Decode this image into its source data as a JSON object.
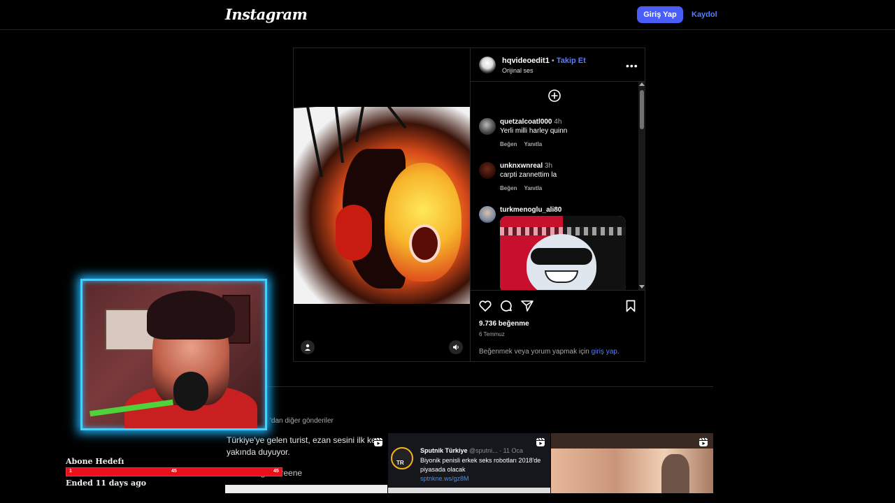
{
  "header": {
    "logo": "Instagram",
    "login_label": "Giriş Yap",
    "signup_label": "Kaydol"
  },
  "post": {
    "author": "hqvideoedit1",
    "separator": " • ",
    "follow_label": "Takip Et",
    "audio": "Orijinal ses",
    "more_label": "•••",
    "comments": [
      {
        "user": "quetzalcoatl000",
        "time": "4h",
        "text": "Yerli milli harley quinn",
        "like_label": "Beğen",
        "reply_label": "Yanıtla"
      },
      {
        "user": "unknxwnreal",
        "time": "3h",
        "text": "carpti zannettim la",
        "like_label": "Beğen",
        "reply_label": "Yanıtla"
      },
      {
        "user": "turkmenoglu_ali80"
      }
    ],
    "likes": "9.736 beğenme",
    "date": "6 Temmuz",
    "login_prompt_prefix": "Beğenmek veya yorum yapmak için ",
    "login_prompt_link": "giriş yap",
    "login_prompt_suffix": "."
  },
  "more_posts": {
    "heading": "'dan diğer gönderiler",
    "thumbs": [
      {
        "text": "Türkiye'ye gelen turist, ezan sesini ilk kez yakında duyuyor.",
        "name": "Danoğlu Greene"
      },
      {
        "logo_text": "TR",
        "account": "Sputnik Türkiye",
        "handle": "@sputni... · 11 Oca",
        "text": "Biyonik penisli erkek seks robotları 2018'de piyasada olacak",
        "link": "sptnkne.ws/gz8M"
      },
      {}
    ]
  },
  "overlay": {
    "goal_title": "Abone Hedefı",
    "goal_start": "1",
    "goal_mid": "45",
    "goal_end": "45",
    "goal_progress": 1.0,
    "goal_status": "Ended 11 days ago"
  },
  "colors": {
    "accent": "#4a5df9",
    "link": "#5a7dff",
    "cam_border": "#38d6ff",
    "goal_bar": "#e8101a"
  }
}
